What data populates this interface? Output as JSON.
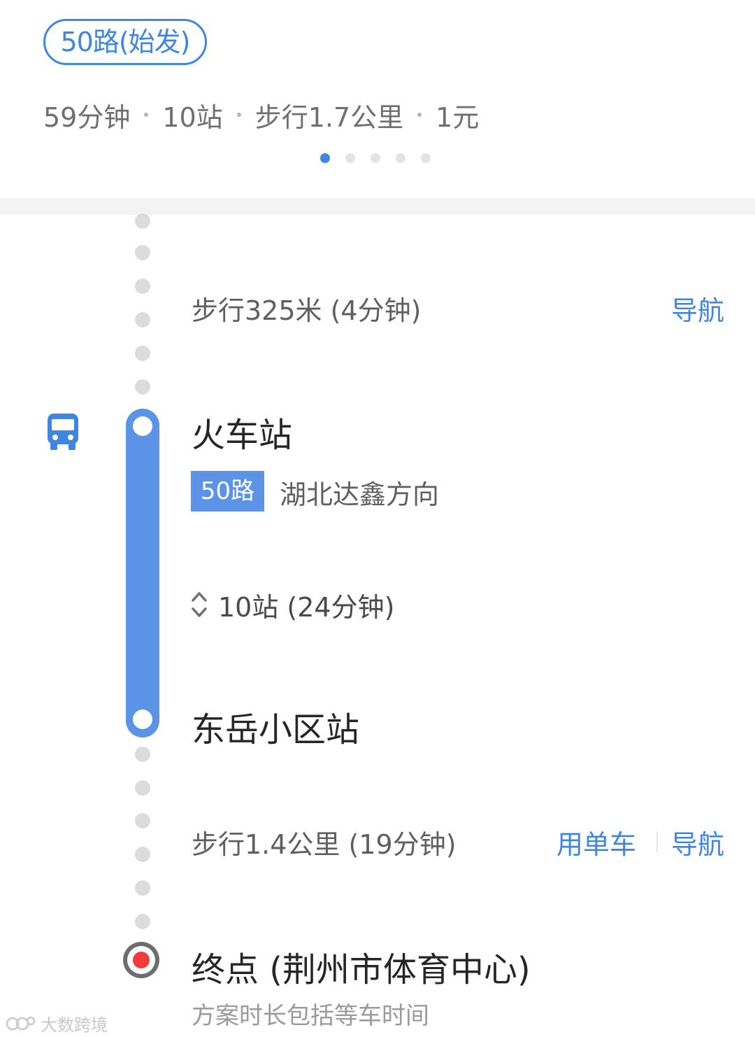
{
  "route": {
    "badge": "50路(始发)",
    "summary": {
      "duration": "59分钟",
      "stops": "10站",
      "walk": "步行1.7公里",
      "fare": "1元"
    },
    "pager": {
      "count": 5,
      "active_index": 0
    }
  },
  "colors": {
    "accent": "#3f86e0",
    "bus_line": "#5b93e6",
    "end_marker": "#f23b3b"
  },
  "segments": {
    "walk1": {
      "text": "步行325米 (4分钟)",
      "nav_label": "导航"
    },
    "bus": {
      "icon": "bus-icon",
      "board_station": "火车站",
      "line_tag": "50路",
      "direction": "湖北达鑫方向",
      "expand_icon": "expand-chevrons-icon",
      "ride_summary": "10站 (24分钟)",
      "alight_station": "东岳小区站"
    },
    "walk2": {
      "text": "步行1.4公里 (19分钟)",
      "bike_label": "用单车",
      "nav_label": "导航"
    },
    "end": {
      "label": "终点 (荆州市体育中心)",
      "note": "方案时长包括等车时间"
    }
  },
  "watermark": {
    "text": "大数跨境"
  }
}
